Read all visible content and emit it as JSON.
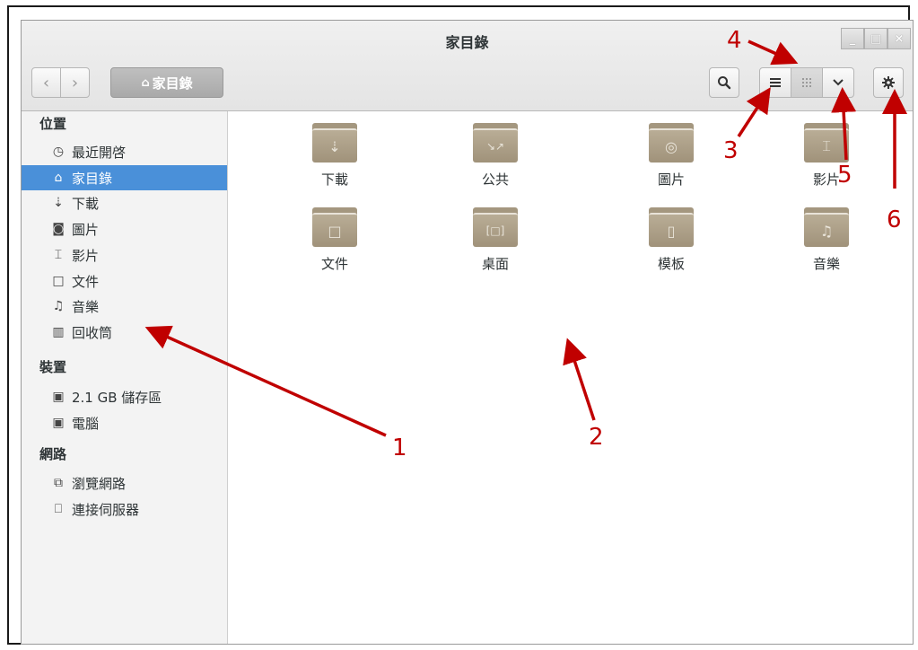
{
  "window": {
    "title": "家目錄",
    "controls": {
      "minimize": "_",
      "maximize": "□",
      "close": "×"
    }
  },
  "toolbar": {
    "back_icon": "chevron-left-icon",
    "forward_icon": "chevron-right-icon",
    "path_label": "家目錄",
    "search_icon": "search-icon",
    "list_view_icon": "list-icon",
    "grid_view_icon": "grid-icon",
    "view_menu_icon": "chevron-down-icon",
    "settings_icon": "gear-icon"
  },
  "sidebar": {
    "sections": [
      {
        "heading": "位置",
        "items": [
          {
            "label": "最近開啓",
            "icon": "clock-icon",
            "active": false
          },
          {
            "label": "家目錄",
            "icon": "home-icon",
            "active": true
          },
          {
            "label": "下載",
            "icon": "download-icon",
            "active": false
          },
          {
            "label": "圖片",
            "icon": "camera-icon",
            "active": false
          },
          {
            "label": "影片",
            "icon": "film-icon",
            "active": false
          },
          {
            "label": "文件",
            "icon": "document-icon",
            "active": false
          },
          {
            "label": "音樂",
            "icon": "music-icon",
            "active": false
          },
          {
            "label": "回收筒",
            "icon": "trash-icon",
            "active": false
          }
        ]
      },
      {
        "heading": "裝置",
        "items": [
          {
            "label": "2.1 GB 儲存區",
            "icon": "drive-icon",
            "active": false
          },
          {
            "label": "電腦",
            "icon": "drive-icon",
            "active": false
          }
        ]
      },
      {
        "heading": "網路",
        "items": [
          {
            "label": "瀏覽網路",
            "icon": "network-icon",
            "active": false
          },
          {
            "label": "連接伺服器",
            "icon": "server-icon",
            "active": false
          }
        ]
      }
    ]
  },
  "folders": [
    {
      "label": "下載",
      "icon": "download-icon"
    },
    {
      "label": "公共",
      "icon": "share-icon"
    },
    {
      "label": "圖片",
      "icon": "camera-icon"
    },
    {
      "label": "影片",
      "icon": "film-icon"
    },
    {
      "label": "文件",
      "icon": "document-icon"
    },
    {
      "label": "桌面",
      "icon": "desktop-icon"
    },
    {
      "label": "模板",
      "icon": "template-icon"
    },
    {
      "label": "音樂",
      "icon": "music-icon"
    }
  ],
  "annotations": {
    "color": "#c00000",
    "labels": [
      "1",
      "2",
      "3",
      "4",
      "5",
      "6"
    ]
  }
}
